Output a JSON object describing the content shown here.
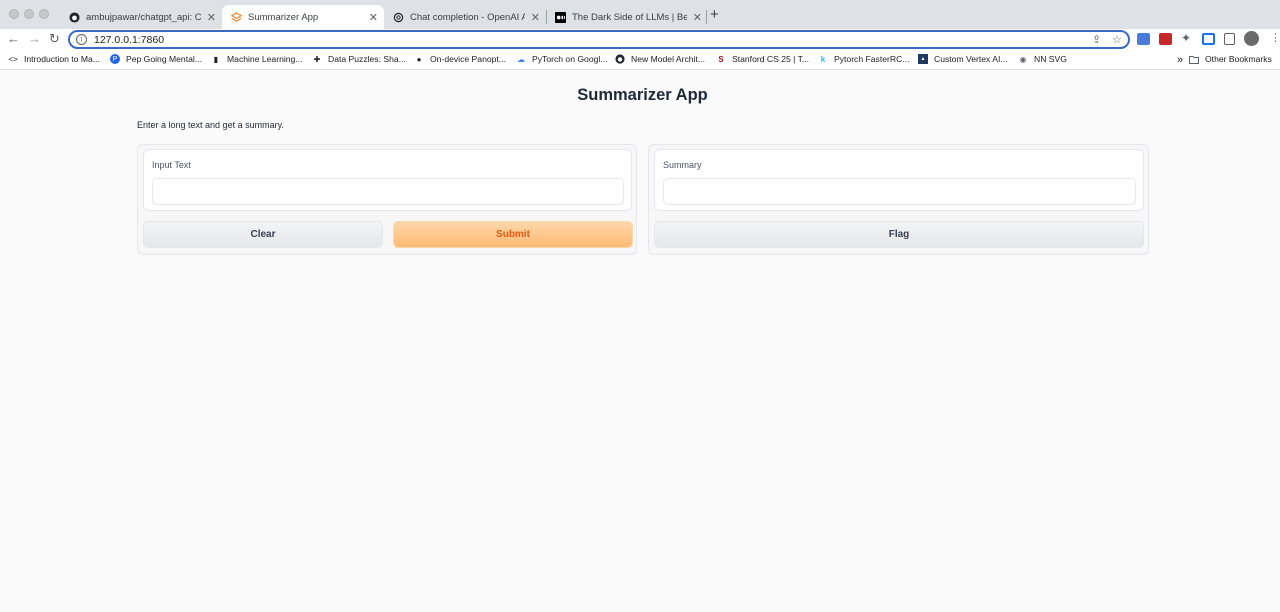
{
  "browser": {
    "tabs": [
      {
        "title": "ambujpawar/chatgpt_api: Code",
        "icon": "github-icon"
      },
      {
        "title": "Summarizer App",
        "icon": "gradio-icon"
      },
      {
        "title": "Chat completion - OpenAI API",
        "icon": "openai-icon"
      },
      {
        "title": "The Dark Side of LLMs | Better",
        "icon": "medium-icon"
      }
    ],
    "url": "127.0.0.1:7860",
    "bookmarks": [
      {
        "label": "Introduction to Ma...",
        "icon": "code-icon"
      },
      {
        "label": "Pep Going Mental...",
        "icon": "p-icon"
      },
      {
        "label": "Machine Learning...",
        "icon": "bookmark-icon"
      },
      {
        "label": "Data Puzzles: Sha...",
        "icon": "puzzle-icon"
      },
      {
        "label": "On-device Panopt...",
        "icon": "apple-icon"
      },
      {
        "label": "PyTorch on Googl...",
        "icon": "cloud-icon"
      },
      {
        "label": "New Model Archit...",
        "icon": "github-icon"
      },
      {
        "label": "Stanford CS 25 | T...",
        "icon": "stanford-icon"
      },
      {
        "label": "Pytorch FasterRC...",
        "icon": "k-icon"
      },
      {
        "label": "Custom Vertex AI...",
        "icon": "vertex-icon"
      },
      {
        "label": "NN SVG",
        "icon": "globe-icon"
      }
    ],
    "other_bookmarks": "Other Bookmarks",
    "more": "»"
  },
  "app": {
    "title": "Summarizer App",
    "description": "Enter a long text and get a summary.",
    "input_label": "Input Text",
    "input_value": "",
    "output_label": "Summary",
    "output_value": "",
    "clear_label": "Clear",
    "submit_label": "Submit",
    "flag_label": "Flag"
  },
  "colors": {
    "accent": "#ea580c",
    "primary_button": "#fdba74",
    "omnibox_focus": "#3b69c9"
  }
}
